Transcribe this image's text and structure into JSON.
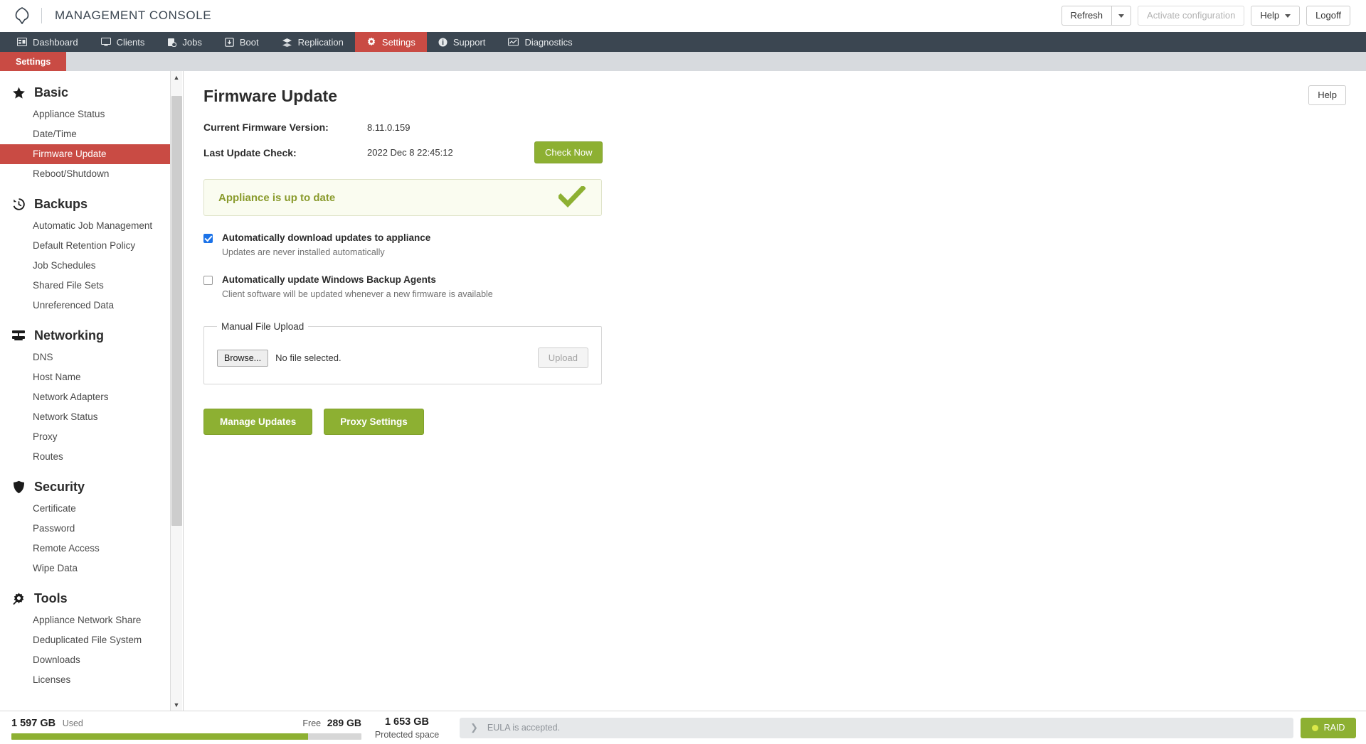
{
  "header": {
    "logo_icon": "appliance-logo-icon",
    "brand_title": "MANAGEMENT CONSOLE",
    "refresh_label": "Refresh",
    "activate_label": "Activate configuration",
    "help_label": "Help",
    "logoff_label": "Logoff"
  },
  "mainnav": {
    "items": [
      {
        "label": "Dashboard",
        "icon": "dashboard-icon",
        "active": false
      },
      {
        "label": "Clients",
        "icon": "monitor-icon",
        "active": false
      },
      {
        "label": "Jobs",
        "icon": "clipboard-icon",
        "active": false
      },
      {
        "label": "Boot",
        "icon": "boot-icon",
        "active": false
      },
      {
        "label": "Replication",
        "icon": "layers-icon",
        "active": false
      },
      {
        "label": "Settings",
        "icon": "gear-icon",
        "active": true
      },
      {
        "label": "Support",
        "icon": "info-icon",
        "active": false
      },
      {
        "label": "Diagnostics",
        "icon": "chart-icon",
        "active": false
      }
    ]
  },
  "subbar": {
    "tab_label": "Settings"
  },
  "sidebar": {
    "groups": [
      {
        "title": "Basic",
        "icon": "star-icon",
        "items": [
          {
            "label": "Appliance Status",
            "active": false
          },
          {
            "label": "Date/Time",
            "active": false
          },
          {
            "label": "Firmware Update",
            "active": true
          },
          {
            "label": "Reboot/Shutdown",
            "active": false
          }
        ]
      },
      {
        "title": "Backups",
        "icon": "history-clock-icon",
        "items": [
          {
            "label": "Automatic Job Management",
            "active": false
          },
          {
            "label": "Default Retention Policy",
            "active": false
          },
          {
            "label": "Job Schedules",
            "active": false
          },
          {
            "label": "Shared File Sets",
            "active": false
          },
          {
            "label": "Unreferenced Data",
            "active": false
          }
        ]
      },
      {
        "title": "Networking",
        "icon": "server-rack-icon",
        "items": [
          {
            "label": "DNS",
            "active": false
          },
          {
            "label": "Host Name",
            "active": false
          },
          {
            "label": "Network Adapters",
            "active": false
          },
          {
            "label": "Network Status",
            "active": false
          },
          {
            "label": "Proxy",
            "active": false
          },
          {
            "label": "Routes",
            "active": false
          }
        ]
      },
      {
        "title": "Security",
        "icon": "shield-icon",
        "items": [
          {
            "label": "Certificate",
            "active": false
          },
          {
            "label": "Password",
            "active": false
          },
          {
            "label": "Remote Access",
            "active": false
          },
          {
            "label": "Wipe Data",
            "active": false
          }
        ]
      },
      {
        "title": "Tools",
        "icon": "tools-gear-icon",
        "items": [
          {
            "label": "Appliance Network Share",
            "active": false
          },
          {
            "label": "Deduplicated File System",
            "active": false
          },
          {
            "label": "Downloads",
            "active": false
          },
          {
            "label": "Licenses",
            "active": false
          }
        ]
      }
    ]
  },
  "content": {
    "page_title": "Firmware Update",
    "help_label": "Help",
    "current_version_label": "Current Firmware Version:",
    "current_version_value": "8.11.0.159",
    "last_check_label": "Last Update Check:",
    "last_check_value": "2022 Dec 8 22:45:12",
    "check_now_label": "Check Now",
    "status_text": "Appliance is up to date",
    "status_icon": "check-mark-icon",
    "checkbox_auto_download": {
      "title": "Automatically download updates to appliance",
      "subtitle": "Updates are never installed automatically",
      "checked": true
    },
    "checkbox_auto_agents": {
      "title": "Automatically update Windows Backup Agents",
      "subtitle": "Client software will be updated whenever a new firmware is available",
      "checked": false
    },
    "upload": {
      "legend": "Manual File Upload",
      "browse_label": "Browse...",
      "file_status": "No file selected.",
      "upload_label": "Upload"
    },
    "manage_updates_label": "Manage Updates",
    "proxy_settings_label": "Proxy Settings"
  },
  "footer": {
    "used_value": "1 597 GB",
    "used_label": "Used",
    "free_label": "Free",
    "free_value": "289 GB",
    "used_percent": 84.7,
    "protected_value": "1 653 GB",
    "protected_label": "Protected space",
    "eula_text": "EULA is accepted.",
    "raid_label": "RAID"
  },
  "colors": {
    "accent_red": "#c94b44",
    "accent_green": "#8db032",
    "nav_dark": "#3b4651",
    "checkbox_blue": "#1b72e8"
  }
}
